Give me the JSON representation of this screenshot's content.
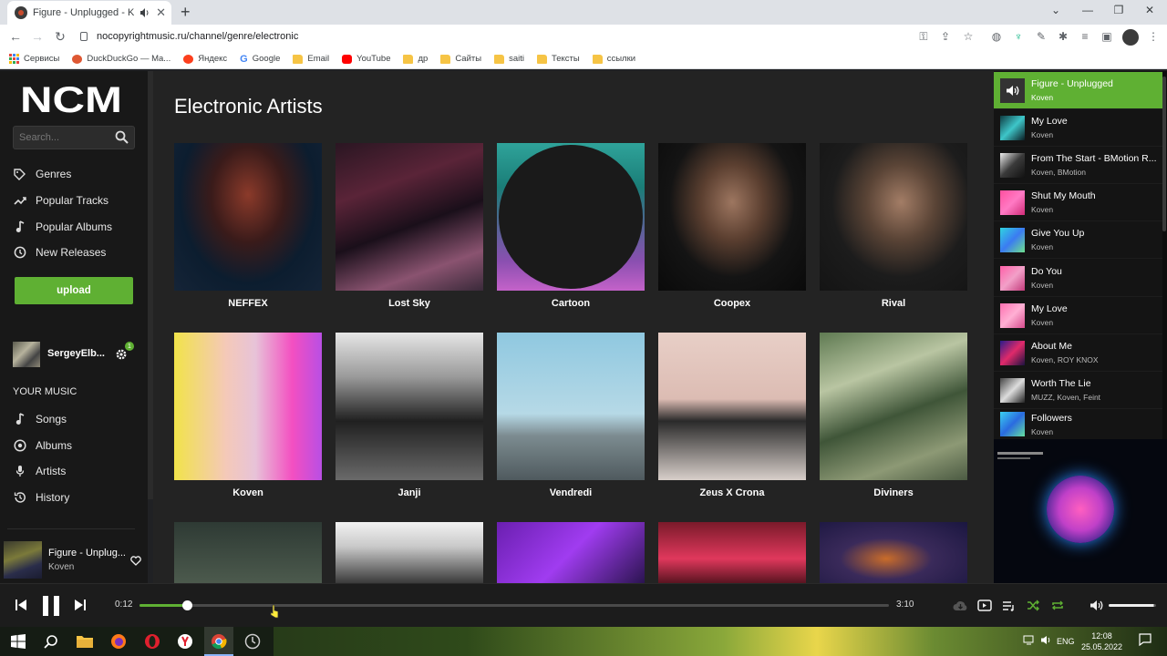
{
  "browser": {
    "tab_title": "Figure - Unplugged - Koven",
    "url": "nocopyrightmusic.ru/channel/genre/electronic",
    "bookmarks": [
      "Сервисы",
      "DuckDuckGo — Ma...",
      "Яндекс",
      "Google",
      "Email",
      "YouTube",
      "др",
      "Сайты",
      "saiti",
      "Тексты",
      "ссылки"
    ]
  },
  "sidebar": {
    "logo": "NCM",
    "search_placeholder": "Search...",
    "nav": [
      "Genres",
      "Popular Tracks",
      "Popular Albums",
      "New Releases"
    ],
    "upload_label": "upload",
    "user_name": "SergeyElb...",
    "notification_count": "1",
    "your_music_heading": "YOUR MUSIC",
    "library": [
      "Songs",
      "Albums",
      "Artists",
      "History"
    ]
  },
  "main": {
    "title": "Electronic Artists",
    "artists": [
      "NEFFEX",
      "Lost Sky",
      "Cartoon",
      "Coopex",
      "Rival",
      "Koven",
      "Janji",
      "Vendredi",
      "Zeus X Crona",
      "Diviners"
    ]
  },
  "queue": [
    {
      "title": "Figure - Unplugged",
      "artist": "Koven",
      "active": true
    },
    {
      "title": "My Love",
      "artist": "Koven"
    },
    {
      "title": "From The Start - BMotion R...",
      "artist": "Koven, BMotion"
    },
    {
      "title": "Shut My Mouth",
      "artist": "Koven"
    },
    {
      "title": "Give You Up",
      "artist": "Koven"
    },
    {
      "title": "Do You",
      "artist": "Koven"
    },
    {
      "title": "My Love",
      "artist": "Koven"
    },
    {
      "title": "About Me",
      "artist": "Koven, ROY KNOX"
    },
    {
      "title": "Worth The Lie",
      "artist": "MUZZ, Koven, Feint"
    },
    {
      "title": "Followers",
      "artist": "Koven"
    }
  ],
  "now_playing": {
    "title": "Figure - Unplug...",
    "artist": "Koven"
  },
  "player": {
    "current_time": "0:12",
    "duration": "3:10",
    "progress": 0.063,
    "volume": 0.95
  },
  "taskbar": {
    "language": "ENG",
    "time": "12:08",
    "date": "25.05.2022"
  },
  "colors": {
    "accent": "#5fb033",
    "background": "#232323",
    "sidebar": "#181818"
  }
}
